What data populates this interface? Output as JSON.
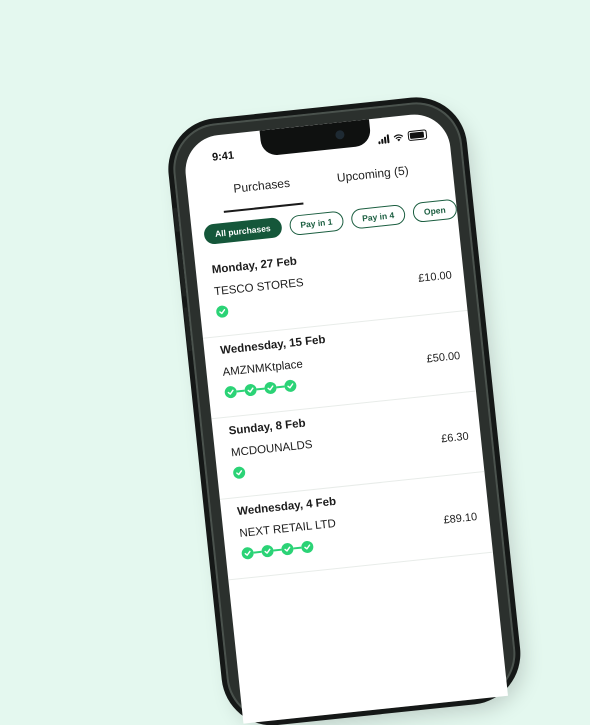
{
  "status": {
    "time": "9:41"
  },
  "tabs": [
    {
      "label": "Purchases",
      "active": true
    },
    {
      "label": "Upcoming (5)",
      "active": false
    }
  ],
  "filters": [
    {
      "label": "All purchases",
      "active": true
    },
    {
      "label": "Pay in 1",
      "active": false
    },
    {
      "label": "Pay in 4",
      "active": false
    },
    {
      "label": "Open",
      "active": false
    }
  ],
  "purchases": [
    {
      "date": "Monday, 27 Feb",
      "merchant": "TESCO STORES",
      "amount": "£10.00",
      "payments_paid": 1
    },
    {
      "date": "Wednesday, 15 Feb",
      "merchant": "AMZNMKtplace",
      "amount": "£50.00",
      "payments_paid": 4
    },
    {
      "date": "Sunday, 8 Feb",
      "merchant": "MCDOUNALDS",
      "amount": "£6.30",
      "payments_paid": 1
    },
    {
      "date": "Wednesday, 4 Feb",
      "merchant": "NEXT RETAIL LTD",
      "amount": "£89.10",
      "payments_paid": 4
    }
  ],
  "colors": {
    "accent": "#15573a",
    "success": "#2bd376",
    "background": "#e4f8ef"
  }
}
